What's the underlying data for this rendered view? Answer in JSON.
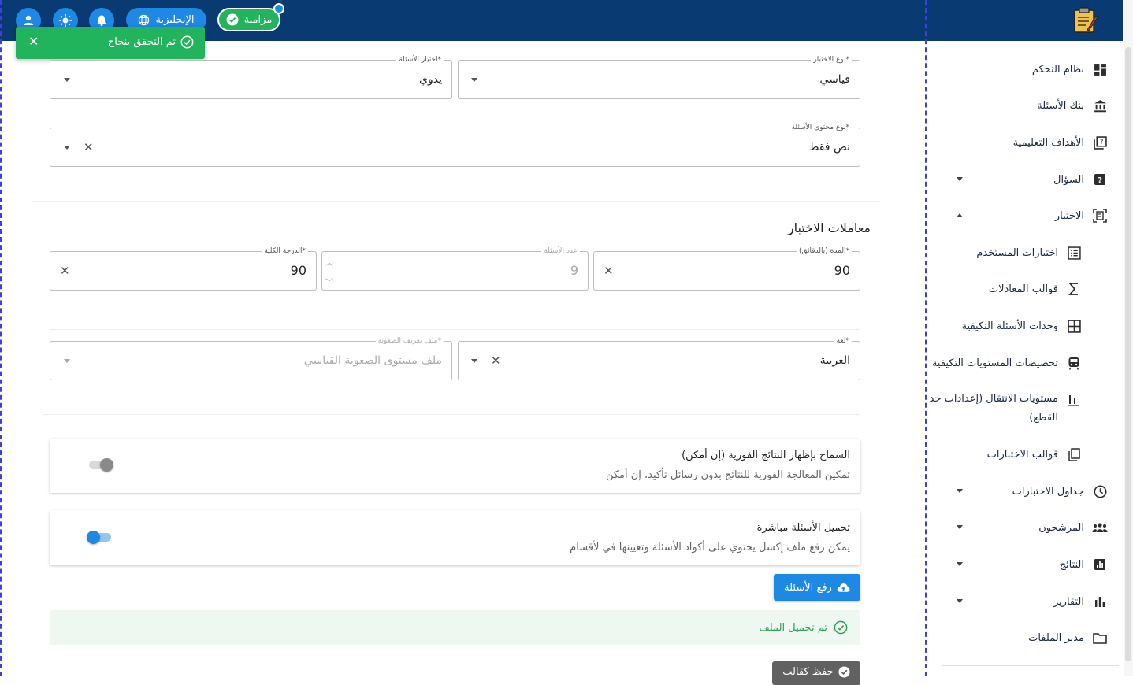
{
  "header": {
    "sync_label": "مزامنة",
    "language_label": "الإنجليزية",
    "icons": [
      "user-icon",
      "brightness-icon",
      "bell-icon",
      "globe-icon",
      "check-circle-icon"
    ]
  },
  "toast": {
    "message": "تم التحقق بنجاح",
    "color": "#22b45c"
  },
  "form": {
    "exam_type": {
      "label": "نوع الاختبار*",
      "value": "قياسي"
    },
    "question_selection": {
      "label": "اختيار الأسئلة*",
      "value": "يدوي"
    },
    "question_content_type": {
      "label": "نوع محتوى الأسئلة*",
      "value": "نص فقط"
    },
    "params_title": "معاملات الاختبار",
    "duration": {
      "label": "المدة (بالدقائق)*",
      "value": "90"
    },
    "question_count": {
      "label": "عدد الأسئلة",
      "value": "9"
    },
    "total_score": {
      "label": "الدرجة الكلية*",
      "value": "90"
    },
    "language": {
      "label": "لغة*",
      "value": "العربية"
    },
    "difficulty_profile": {
      "label": "ملف تعريف الصعوبة*",
      "value": "ملف مستوى الصعوبة القياسي"
    }
  },
  "settings": {
    "instant_results": {
      "title": "السماح بإظهار النتائج الفورية (إن أمكن)",
      "description": "تمكين المعالجة الفورية للنتائج بدون رسائل تأكيد، إن أمكن",
      "enabled": false
    },
    "direct_upload": {
      "title": "تحميل الأسئلة مباشرة",
      "description": "يمكن رفع ملف إكسل يحتوي على أكواد الأسئلة وتعيينها في لأقسام",
      "enabled": true
    }
  },
  "actions": {
    "upload_label": "رفع الأسئلة",
    "upload_success": "تم تحميل الملف",
    "save_template_label": "حفظ كقالب"
  },
  "sidebar": {
    "items": [
      {
        "label": "نظام التحكم",
        "icon": "dashboard-icon",
        "level": 0
      },
      {
        "label": "بنك الأسئلة",
        "icon": "bank-icon",
        "level": 0
      },
      {
        "label": "الأهداف التعليمية",
        "icon": "objectives-icon",
        "level": 0
      },
      {
        "label": "السؤال",
        "icon": "question-icon",
        "level": 0,
        "expander": "down"
      },
      {
        "label": "الاختبار",
        "icon": "exam-icon",
        "level": 0,
        "expander": "up"
      },
      {
        "label": "اختبارات المستخدم",
        "icon": "list-icon",
        "level": 1
      },
      {
        "label": "قوالب المعادلات",
        "icon": "sigma-icon",
        "level": 1
      },
      {
        "label": "وحدات الأسئلة التكيفية",
        "icon": "grid-icon",
        "level": 1
      },
      {
        "label": "تخصيصات المستويات التكيفية",
        "icon": "train-icon",
        "level": 1
      },
      {
        "label": "مستويات الانتقال (إعدادات حد",
        "label2": "القطع)",
        "icon": "bar-chart-icon",
        "level": 1
      },
      {
        "label": "قوالب الاختبارات",
        "icon": "copy-icon",
        "level": 1
      },
      {
        "label": "جداول الاختبارات",
        "icon": "clock-icon",
        "level": 0,
        "expander": "down"
      },
      {
        "label": "المرشحون",
        "icon": "people-icon",
        "level": 0,
        "expander": "down"
      },
      {
        "label": "النتائج",
        "icon": "results-icon",
        "level": 0,
        "expander": "down"
      },
      {
        "label": "التقارير",
        "icon": "reports-icon",
        "level": 0,
        "expander": "down"
      },
      {
        "label": "مدير الملفات",
        "icon": "folder-icon",
        "level": 0
      }
    ]
  },
  "colors": {
    "header_bg": "#0a3a72",
    "primary": "#1e88e5",
    "success": "#22b45c",
    "save_button": "#616161"
  }
}
